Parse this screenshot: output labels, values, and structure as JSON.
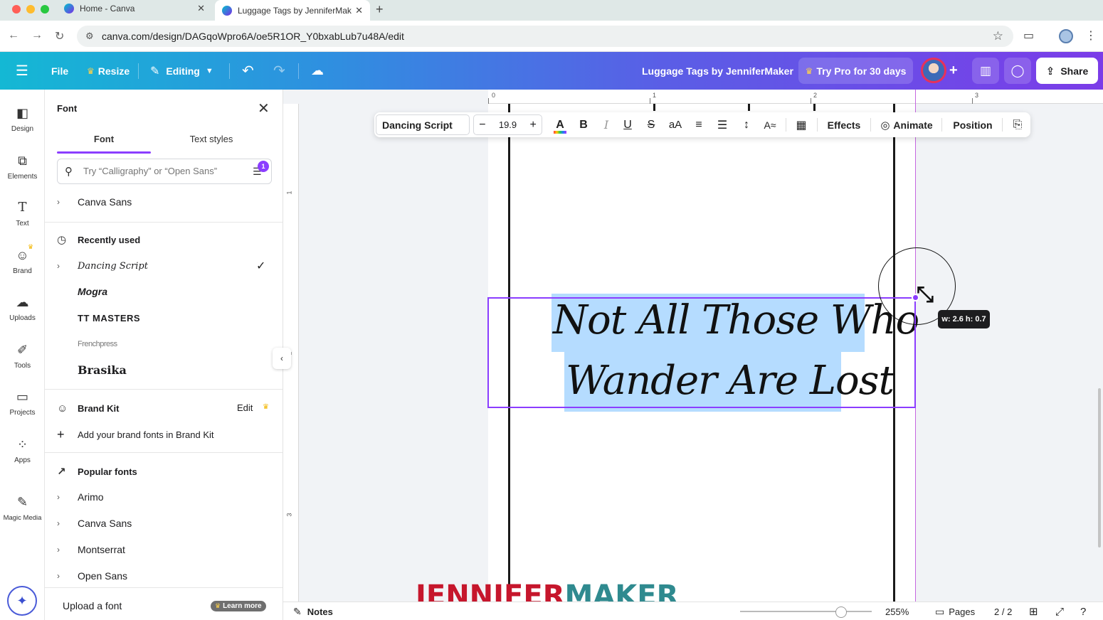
{
  "browser": {
    "tabs": [
      {
        "title": "Home - Canva",
        "active": false
      },
      {
        "title": "Luggage Tags by JenniferMaker",
        "active": true
      }
    ],
    "url": "canva.com/design/DAGqoWpro6A/oe5R1OR_Y0bxabLub7u48A/edit"
  },
  "header": {
    "file": "File",
    "resize": "Resize",
    "editing": "Editing",
    "doc_title": "Luggage Tags by JenniferMaker",
    "try_pro": "Try Pro for 30 days",
    "share": "Share"
  },
  "rail": [
    {
      "label": "Design",
      "icon": "design-icon"
    },
    {
      "label": "Elements",
      "icon": "elements-icon"
    },
    {
      "label": "Text",
      "icon": "text-icon"
    },
    {
      "label": "Brand",
      "icon": "brand-icon"
    },
    {
      "label": "Uploads",
      "icon": "uploads-icon"
    },
    {
      "label": "Tools",
      "icon": "tools-icon"
    },
    {
      "label": "Projects",
      "icon": "projects-icon"
    },
    {
      "label": "Apps",
      "icon": "apps-icon"
    },
    {
      "label": "Magic Media",
      "icon": "magic-media-icon"
    }
  ],
  "font_panel": {
    "title": "Font",
    "tabs": [
      "Font",
      "Text styles"
    ],
    "search_placeholder": "Try “Calligraphy” or “Open Sans”",
    "filter_badge": "1",
    "default_font": "Canva Sans",
    "recently_used_title": "Recently used",
    "recently_used": [
      "Dancing Script",
      "Mogra",
      "TT MASTERS",
      "Frenchpress",
      "Brasika"
    ],
    "brand_kit_title": "Brand Kit",
    "brand_kit_edit": "Edit",
    "add_brand_fonts": "Add your brand fonts in Brand Kit",
    "popular_title": "Popular fonts",
    "popular": [
      "Arimo",
      "Canva Sans",
      "Montserrat",
      "Open Sans"
    ],
    "upload": "Upload a font",
    "learn_more": "Learn more"
  },
  "toolbar": {
    "font": "Dancing Script",
    "size": "19.9",
    "minus": "−",
    "plus": "+",
    "effects": "Effects",
    "animate": "Animate",
    "position": "Position"
  },
  "rulers": {
    "top": [
      "0",
      "1",
      "2",
      "3"
    ],
    "left": [
      "1",
      "2",
      "3"
    ]
  },
  "canvas": {
    "text_line1": "Not All Those Who",
    "text_line2": "Wander Are Lost",
    "dimension_tooltip": "w: 2.6 h: 0.7",
    "selection_color": "#8b3dff",
    "highlight_color": "#b5dcff"
  },
  "watermark": {
    "part1": "JENNIFER",
    "part2": "MAKER"
  },
  "bottom": {
    "notes": "Notes",
    "zoom": "255%",
    "zoom_fraction": 0.77,
    "pages": "Pages",
    "page_count": "2 / 2"
  }
}
